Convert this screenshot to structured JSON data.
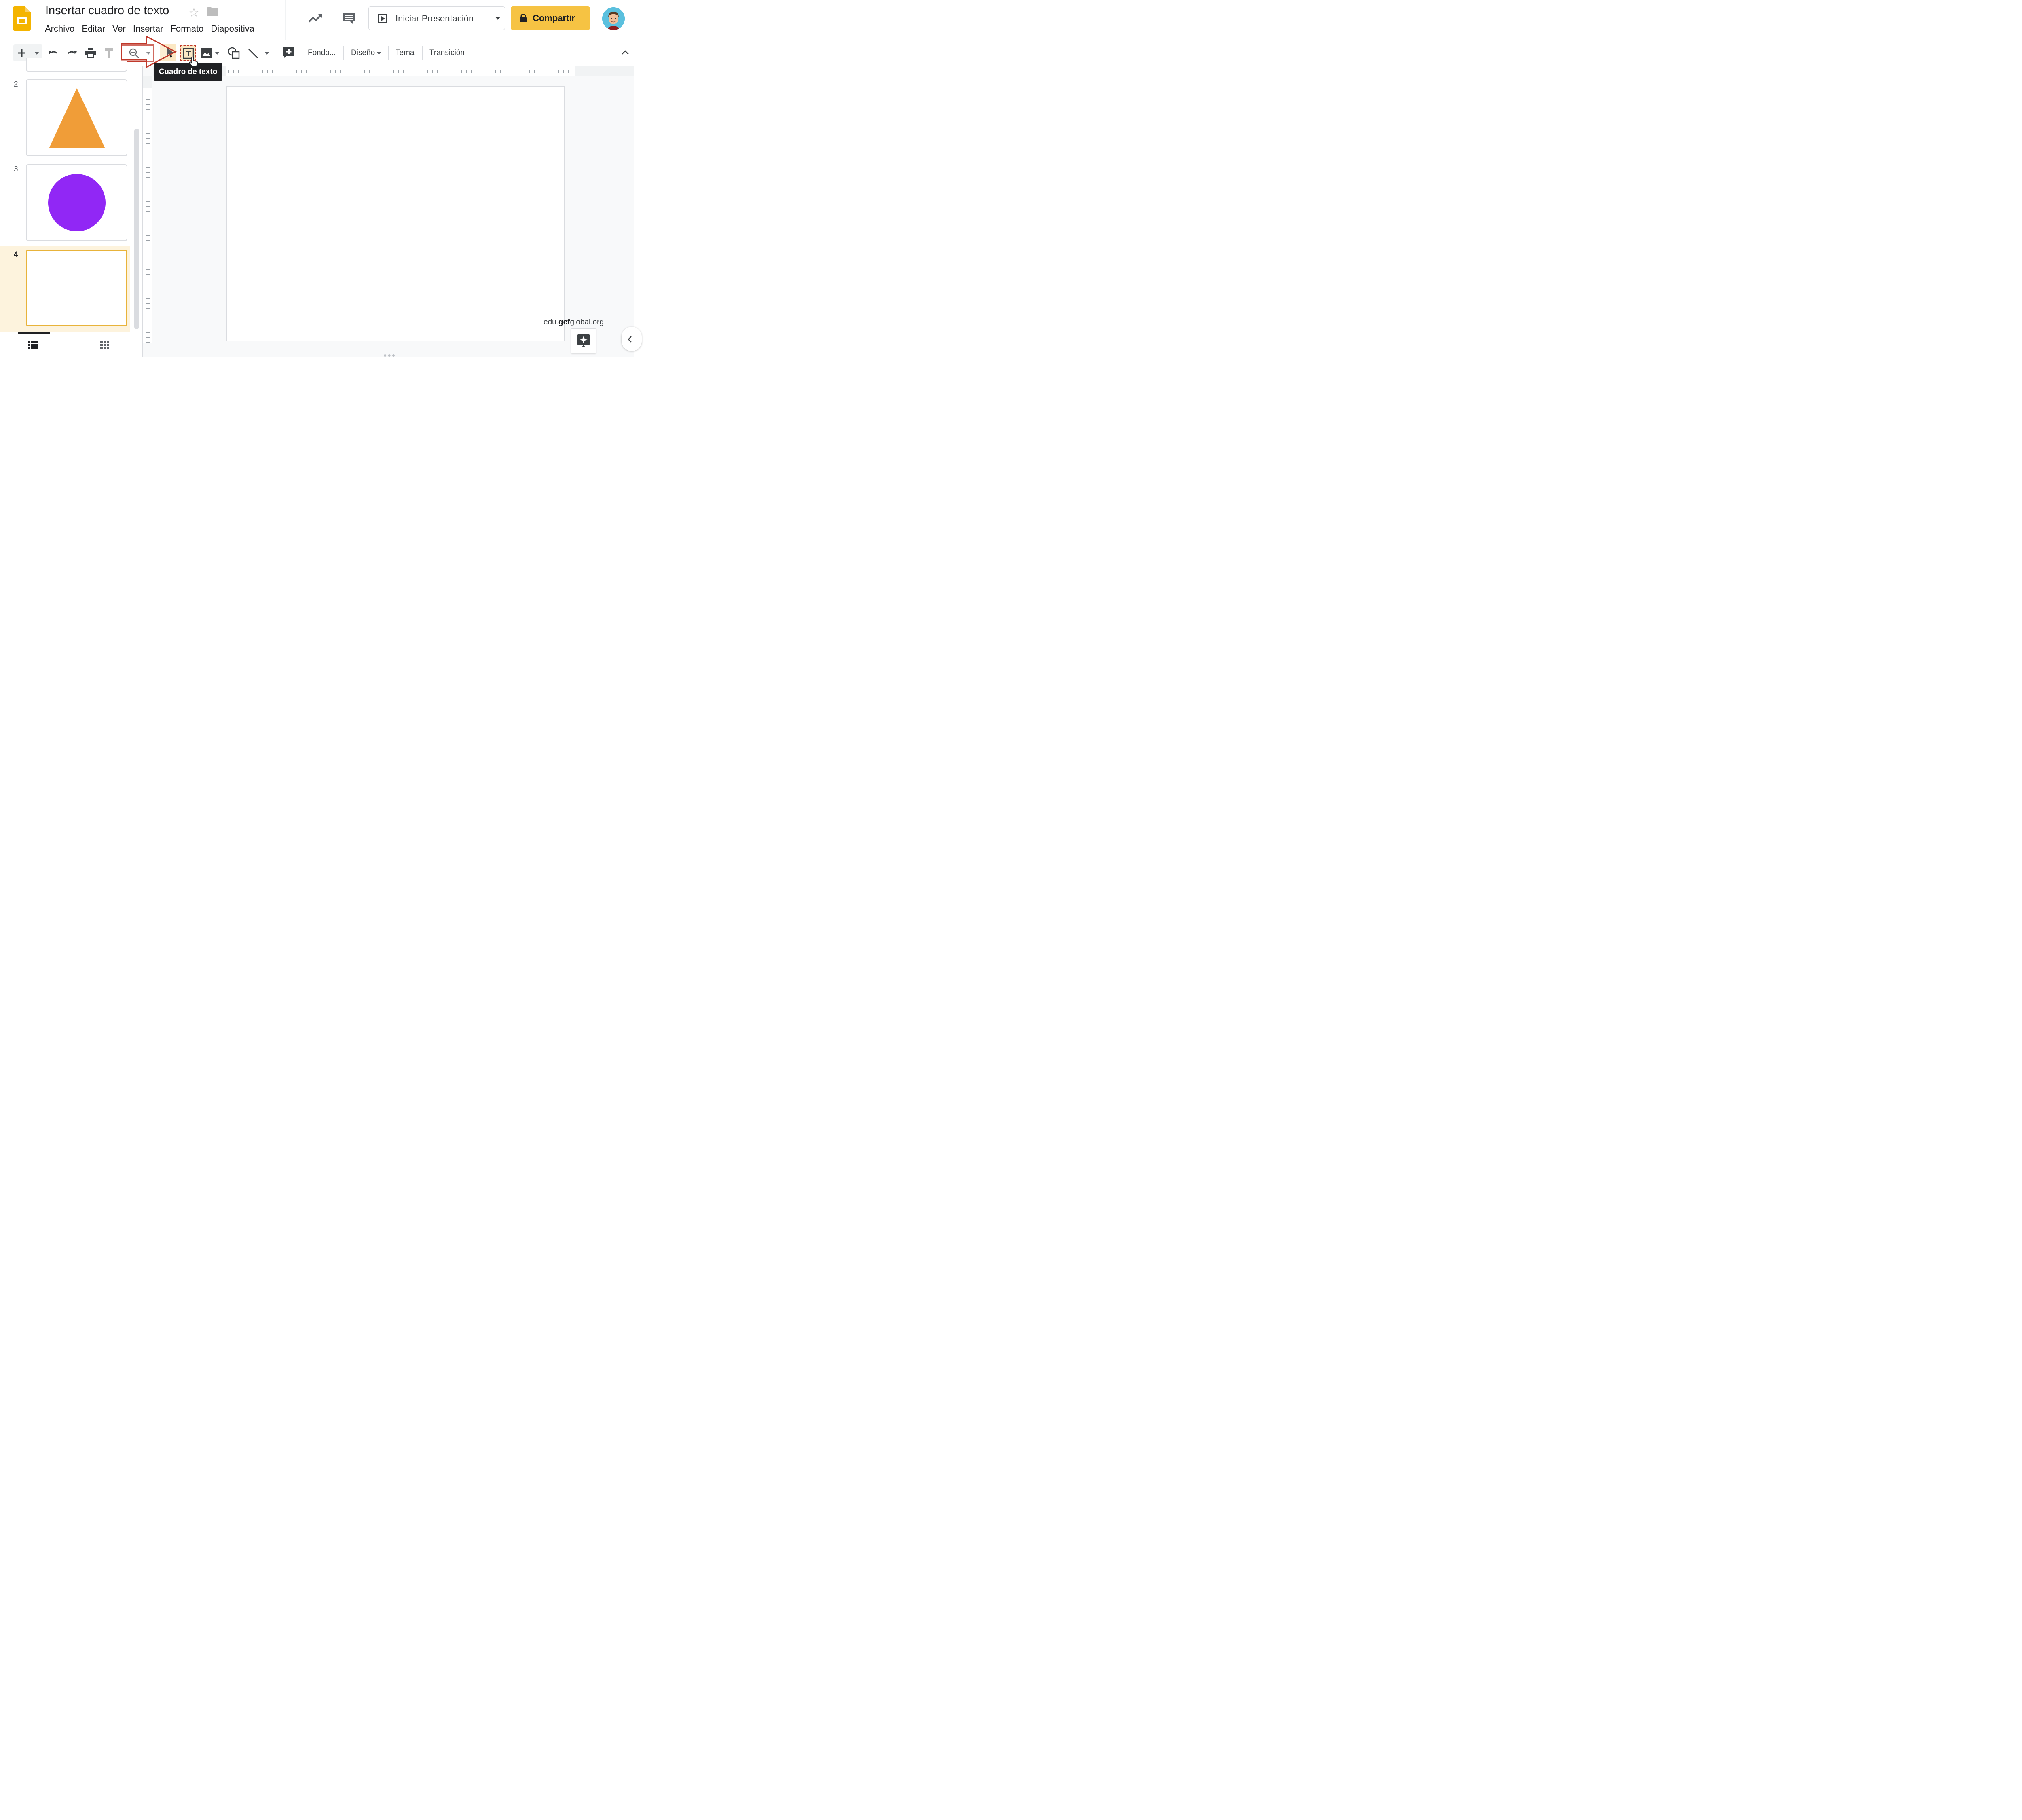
{
  "header": {
    "doc_title": "Insertar cuadro de texto",
    "menus": [
      "Archivo",
      "Editar",
      "Ver",
      "Insertar",
      "Formato",
      "Diapositiva"
    ],
    "present_label": "Iniciar Presentación",
    "share_label": "Compartir"
  },
  "toolbar": {
    "background_label": "Fondo...",
    "layout_label": "Diseño",
    "theme_label": "Tema",
    "transition_label": "Transición",
    "tooltip": "Cuadro de texto"
  },
  "filmstrip": {
    "slides": [
      {
        "number": "2",
        "shape": "triangle",
        "color": "#f09d38"
      },
      {
        "number": "3",
        "shape": "circle",
        "color": "#9127f5"
      },
      {
        "number": "4",
        "shape": "blank",
        "selected": true
      }
    ]
  },
  "watermark": {
    "prefix": "edu.",
    "bold": "gcf",
    "suffix": "global.org"
  },
  "colors": {
    "accent": "#f6c343",
    "annotation": "#c0392b",
    "selection": "#e8b33a"
  }
}
